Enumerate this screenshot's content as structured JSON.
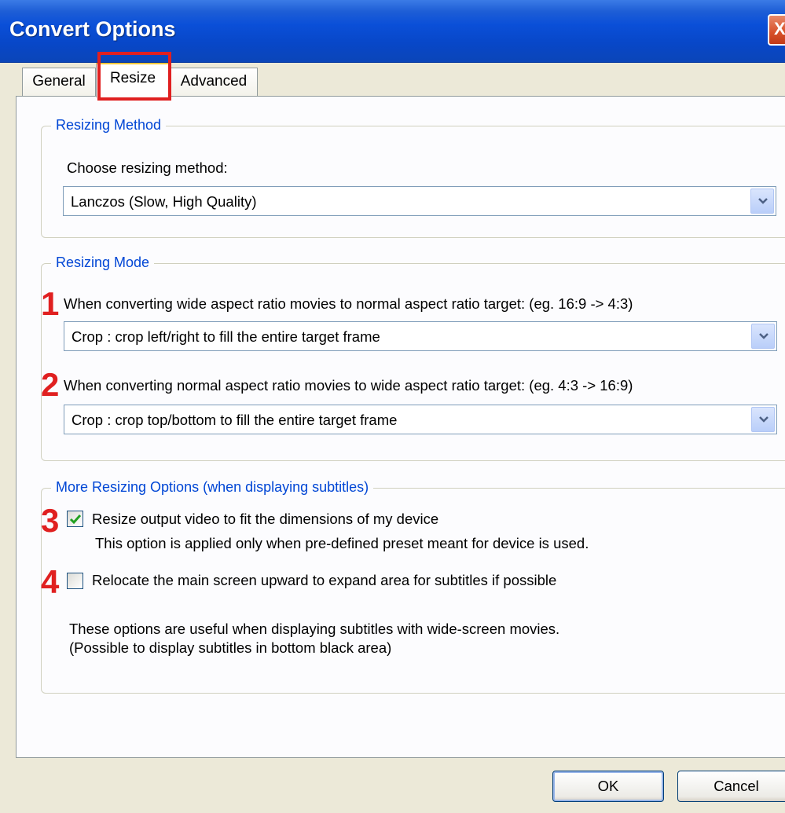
{
  "window": {
    "title": "Convert Options",
    "close_glyph": "X"
  },
  "tabs": [
    {
      "label": "General"
    },
    {
      "label": "Resize"
    },
    {
      "label": "Advanced"
    }
  ],
  "resizing_method": {
    "legend": "Resizing Method",
    "prompt": "Choose resizing method:",
    "selected": "Lanczos (Slow, High Quality)"
  },
  "resizing_mode": {
    "legend": "Resizing Mode",
    "wide_to_normal": {
      "marker": "1",
      "label": "When converting wide aspect ratio movies to normal aspect ratio target: (eg. 16:9 -> 4:3)",
      "selected": "Crop : crop left/right to fill the entire target frame"
    },
    "normal_to_wide": {
      "marker": "2",
      "label": "When converting normal aspect ratio movies to wide aspect ratio target: (eg. 4:3 -> 16:9)",
      "selected": "Crop : crop top/bottom to fill the entire target frame"
    }
  },
  "more_options": {
    "legend": "More Resizing Options (when displaying subtitles)",
    "fit_device": {
      "marker": "3",
      "label": "Resize output video to fit the dimensions of my device",
      "note": "This option is applied only when pre-defined preset meant for device is used.",
      "checked": true
    },
    "relocate": {
      "marker": "4",
      "label": "Relocate the main screen upward to expand area for subtitles if possible",
      "checked": false
    },
    "info_line1": "These options are useful when displaying subtitles with wide-screen movies.",
    "info_line2": "(Possible to display subtitles in bottom black area)"
  },
  "buttons": {
    "ok": "OK",
    "cancel": "Cancel"
  },
  "colors": {
    "titlebar": "#0A4FD8",
    "legend_text": "#0046D5",
    "annotation_red": "#E02020",
    "checkmark": "#21A121"
  },
  "icons": {
    "dropdown": "chevron-down-icon",
    "check": "check-icon",
    "close": "close-icon"
  }
}
